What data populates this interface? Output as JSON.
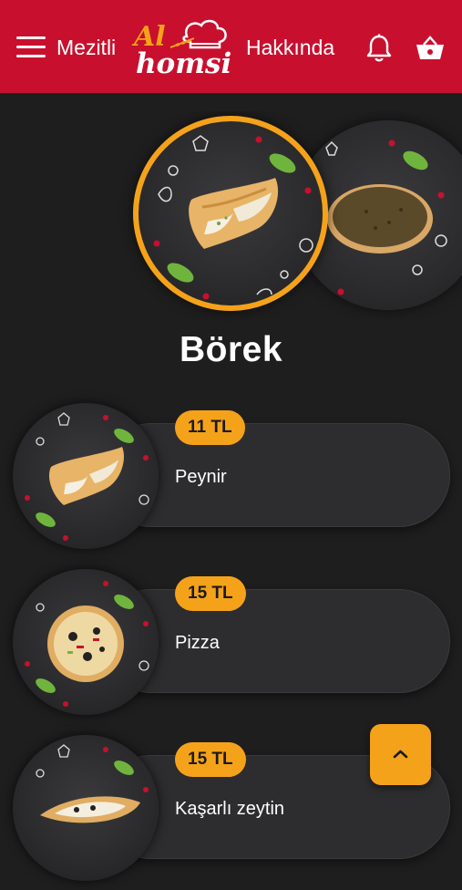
{
  "header": {
    "left_link": "Mezitli",
    "right_link": "Hakkında",
    "logo_top": "Al",
    "logo_bottom": "homsi",
    "background": "#c8102e"
  },
  "carousel": {
    "selected_category": "Börek",
    "items": [
      "borek",
      "lahmacun"
    ]
  },
  "products": [
    {
      "price": "11 TL",
      "name": "Peynir",
      "image": "borek"
    },
    {
      "price": "15 TL",
      "name": "Pizza",
      "image": "pizza"
    },
    {
      "price": "15 TL",
      "name": "Kaşarlı zeytin",
      "image": "pide"
    }
  ],
  "colors": {
    "accent": "#f5a21b",
    "background": "#1e1e1f",
    "card": "#2d2d2f"
  },
  "icons": [
    "menu-icon",
    "bell-icon",
    "basket-icon",
    "chevron-up-icon"
  ]
}
